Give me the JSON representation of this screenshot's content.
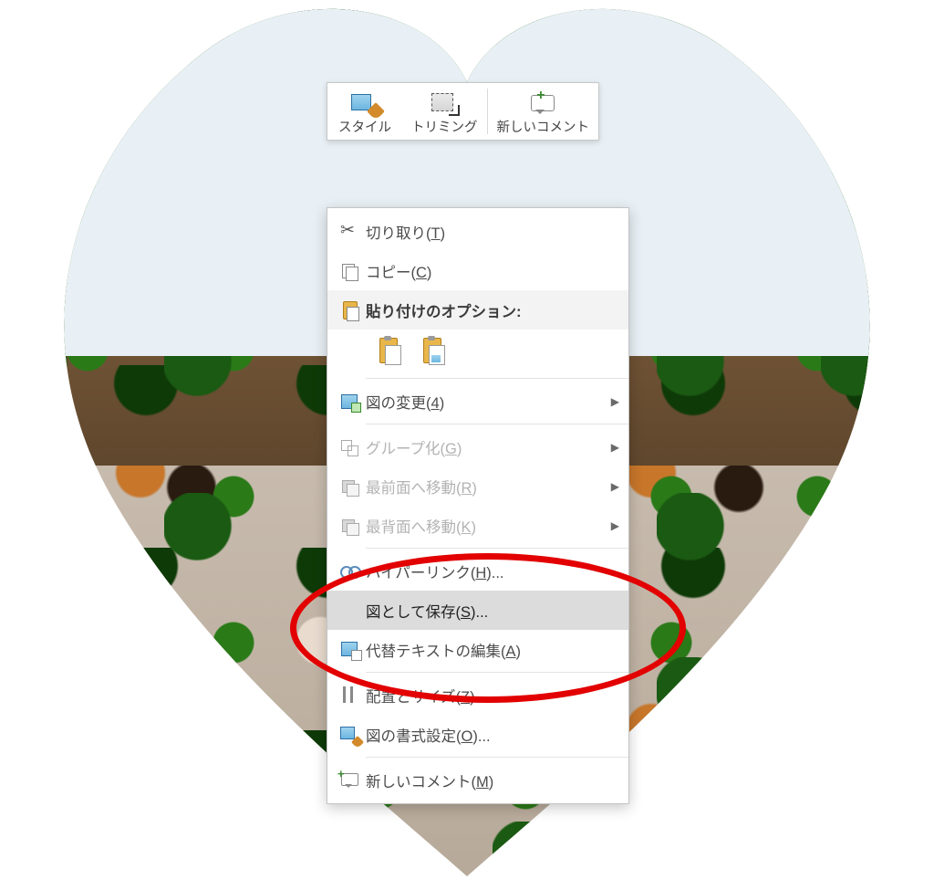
{
  "toolbar": {
    "style_label": "スタイル",
    "crop_label": "トリミング",
    "new_comment_label": "新しいコメント"
  },
  "context_menu": {
    "cut": "切り取り(T)",
    "copy": "コピー(C)",
    "paste_options_header": "貼り付けのオプション:",
    "change_picture": "図の変更(4)",
    "group": "グループ化(G)",
    "bring_front": "最前面へ移動(R)",
    "send_back": "最背面へ移動(K)",
    "hyperlink": "ハイパーリンク(H)...",
    "save_as_picture": "図として保存(S)...",
    "edit_alt_text": "代替テキストの編集(A)",
    "size_position": "配置とサイズ(Z)...",
    "format_picture": "図の書式設定(O)...",
    "new_comment": "新しいコメント(M)"
  },
  "annotation": {
    "highlighted_item": "save_as_picture"
  }
}
